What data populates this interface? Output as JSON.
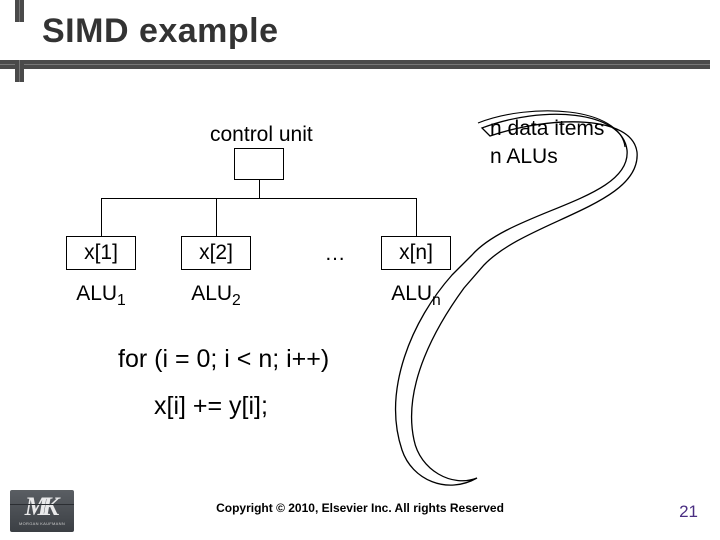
{
  "title": "SIMD example",
  "control_unit_label": "control unit",
  "annotation": {
    "line1": "n data items",
    "line2": "n ALUs"
  },
  "alus": [
    {
      "data": "x[1]",
      "name": "ALU",
      "sub": "1"
    },
    {
      "data": "x[2]",
      "name": "ALU",
      "sub": "2"
    },
    {
      "data": "x[n]",
      "name": "ALU",
      "sub": "n"
    }
  ],
  "ellipsis": "…",
  "code": {
    "line1": "for (i = 0; i < n; i++)",
    "line2": "x[i] += y[i];"
  },
  "footer": {
    "copyright": "Copyright © 2010, Elsevier Inc. All rights Reserved",
    "page": "21"
  },
  "logo": {
    "letters": "MK",
    "publisher": "MORGAN KAUFMANN"
  }
}
